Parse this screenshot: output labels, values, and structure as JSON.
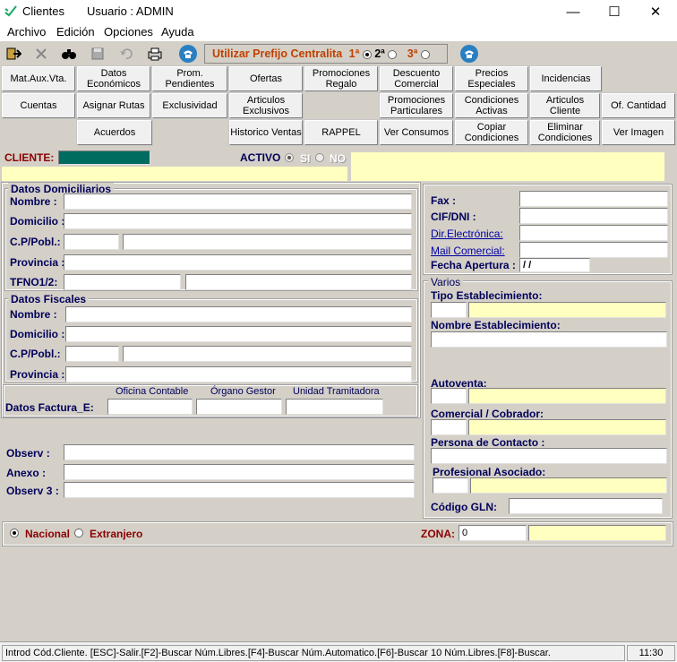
{
  "window": {
    "title": "Clientes",
    "user": "Usuario : ADMIN"
  },
  "menu": [
    "Archivo",
    "Edición",
    "Opciones",
    "Ayuda"
  ],
  "toolbar": {
    "prefijo_label": "Utilizar Prefijo Centralita",
    "opt1": "1ª",
    "opt2": "2ª",
    "opt3": "3ª"
  },
  "buttons": {
    "r1": [
      "Mat.Aux.Vta.",
      "Datos Económicos",
      "Prom. Pendientes",
      "Ofertas",
      "Promociones Regalo",
      "Descuento Comercial",
      "Precios Especiales",
      "Incidencias"
    ],
    "r2": [
      "Cuentas",
      "Asignar Rutas",
      "Exclusividad",
      "Articulos Exclusivos",
      "Promociones Particulares",
      "Condiciones Activas",
      "Articulos Cliente",
      "Of. Cantidad"
    ],
    "r3": [
      "Acuerdos",
      "Historico Ventas",
      "RAPPEL",
      "Ver Consumos",
      "Copiar Condiciones",
      "Eliminar Condiciones",
      "Ver Imagen"
    ]
  },
  "cliente": {
    "label": "CLIENTE:",
    "activo": "ACTIVO",
    "si": "SI",
    "no": "NO"
  },
  "domiciliarios": {
    "title": "Datos Domiciliarios",
    "nombre": "Nombre :",
    "domicilio": "Domicilio :",
    "cp": "C.P/Pobl.:",
    "provincia": "Provincia :",
    "tfno": "TFNO1/2:"
  },
  "fiscales": {
    "title": "Datos Fiscales",
    "nombre": "Nombre :",
    "domicilio": "Domicilio :",
    "cp": "C.P/Pobl.:",
    "provincia": "Provincia :"
  },
  "factura": {
    "label": "Datos Factura_E:",
    "oficina": "Oficina Contable",
    "organo": "Órgano Gestor",
    "unidad": "Unidad Tramitadora"
  },
  "observ": {
    "observ": "Observ :",
    "anexo": "Anexo  :",
    "observ3": "Observ 3 :"
  },
  "right": {
    "fax": "Fax :",
    "cif": "CIF/DNI :",
    "dir": "Dir.Electrónica:",
    "mail": "Mail Comercial:",
    "fecha": "Fecha Apertura :",
    "fecha_val": " /  /"
  },
  "varios": {
    "title": "Varios",
    "tipo": "Tipo Establecimiento:",
    "nombre": "Nombre Establecimiento:",
    "autoventa": "Autoventa:",
    "comercial": "Comercial / Cobrador:",
    "persona": "Persona de Contacto :",
    "profesional": "Profesional Asociado:",
    "gln": "Código GLN:"
  },
  "bottom": {
    "nacional": "Nacional",
    "extranjero": "Extranjero",
    "zona": "ZONA:",
    "zona_val": "0"
  },
  "status": {
    "text": "Introd Cód.Cliente. [ESC]-Salir.[F2]-Buscar Núm.Libres.[F4]-Buscar Núm.Automatico.[F6]-Buscar 10 Núm.Libres.[F8]-Buscar.",
    "time": "11:30"
  }
}
